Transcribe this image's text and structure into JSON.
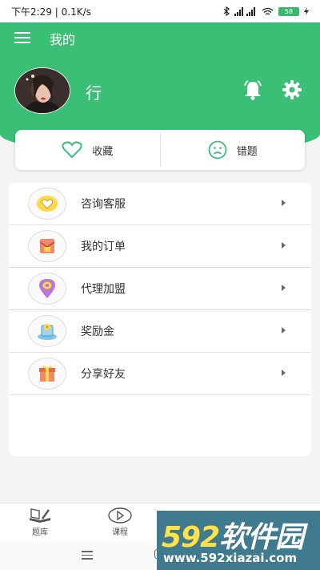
{
  "status_bar": {
    "left_text": "下午2:29 | 0.1K/s",
    "battery": "58"
  },
  "header": {
    "title": "我的",
    "username": "行"
  },
  "quick_actions": [
    {
      "label": "收藏",
      "icon": "heart-icon"
    },
    {
      "label": "错题",
      "icon": "sad-face-icon"
    }
  ],
  "menu_items": [
    {
      "label": "咨询客服",
      "icon": "heart-badge-icon"
    },
    {
      "label": "我的订单",
      "icon": "envelope-icon"
    },
    {
      "label": "代理加盟",
      "icon": "location-pin-icon"
    },
    {
      "label": "奖励金",
      "icon": "coin-box-icon"
    },
    {
      "label": "分享好友",
      "icon": "gift-box-icon"
    }
  ],
  "tabs": [
    {
      "label": "题库",
      "icon": "book-pen-icon"
    },
    {
      "label": "课程",
      "icon": "play-circle-icon"
    },
    {
      "label": "",
      "icon": "shield-icon"
    },
    {
      "label": "",
      "icon": "user-icon"
    }
  ],
  "watermark": {
    "logo_digits": "592",
    "logo_text": "软件园",
    "url": "www.592xiazai.com"
  },
  "colors": {
    "accent": "#3bbf77",
    "watermark_bg": "#3f7a8e",
    "watermark_digits": "#ffe14a"
  }
}
